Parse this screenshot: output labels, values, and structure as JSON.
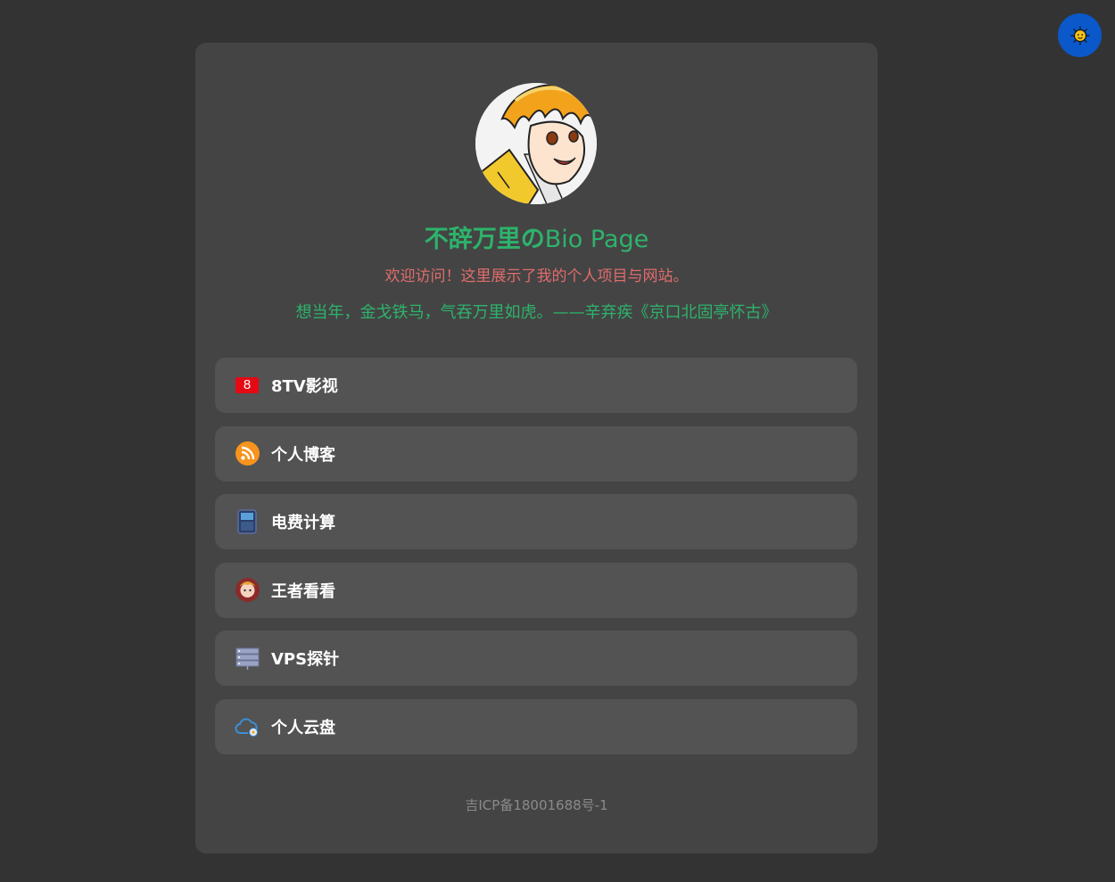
{
  "header": {
    "title_part1": "不辞万里の",
    "title_part2": "Bio Page",
    "welcome": "欢迎访问！这里展示了我的个人项目与网站。",
    "poem": "想当年，金戈铁马，气吞万里如虎。——辛弃疾《京口北固亭怀古》"
  },
  "theme_toggle": {
    "icon": "sun-icon",
    "color": "#0a58ca"
  },
  "links": [
    {
      "label": "8TV影视",
      "icon": "tv-8-icon",
      "icon_glyph": "8"
    },
    {
      "label": "个人博客",
      "icon": "rss-icon"
    },
    {
      "label": "电费计算",
      "icon": "calculator-icon"
    },
    {
      "label": "王者看看",
      "icon": "game-avatar-icon"
    },
    {
      "label": "VPS探针",
      "icon": "server-icon"
    },
    {
      "label": "个人云盘",
      "icon": "cloud-icon"
    }
  ],
  "footer": {
    "icp": "吉ICP备18001688号-1"
  },
  "colors": {
    "background": "#333333",
    "card": "#444444",
    "link_bg": "#535353",
    "accent_green": "#2db36b",
    "accent_red": "#e06c6c"
  }
}
